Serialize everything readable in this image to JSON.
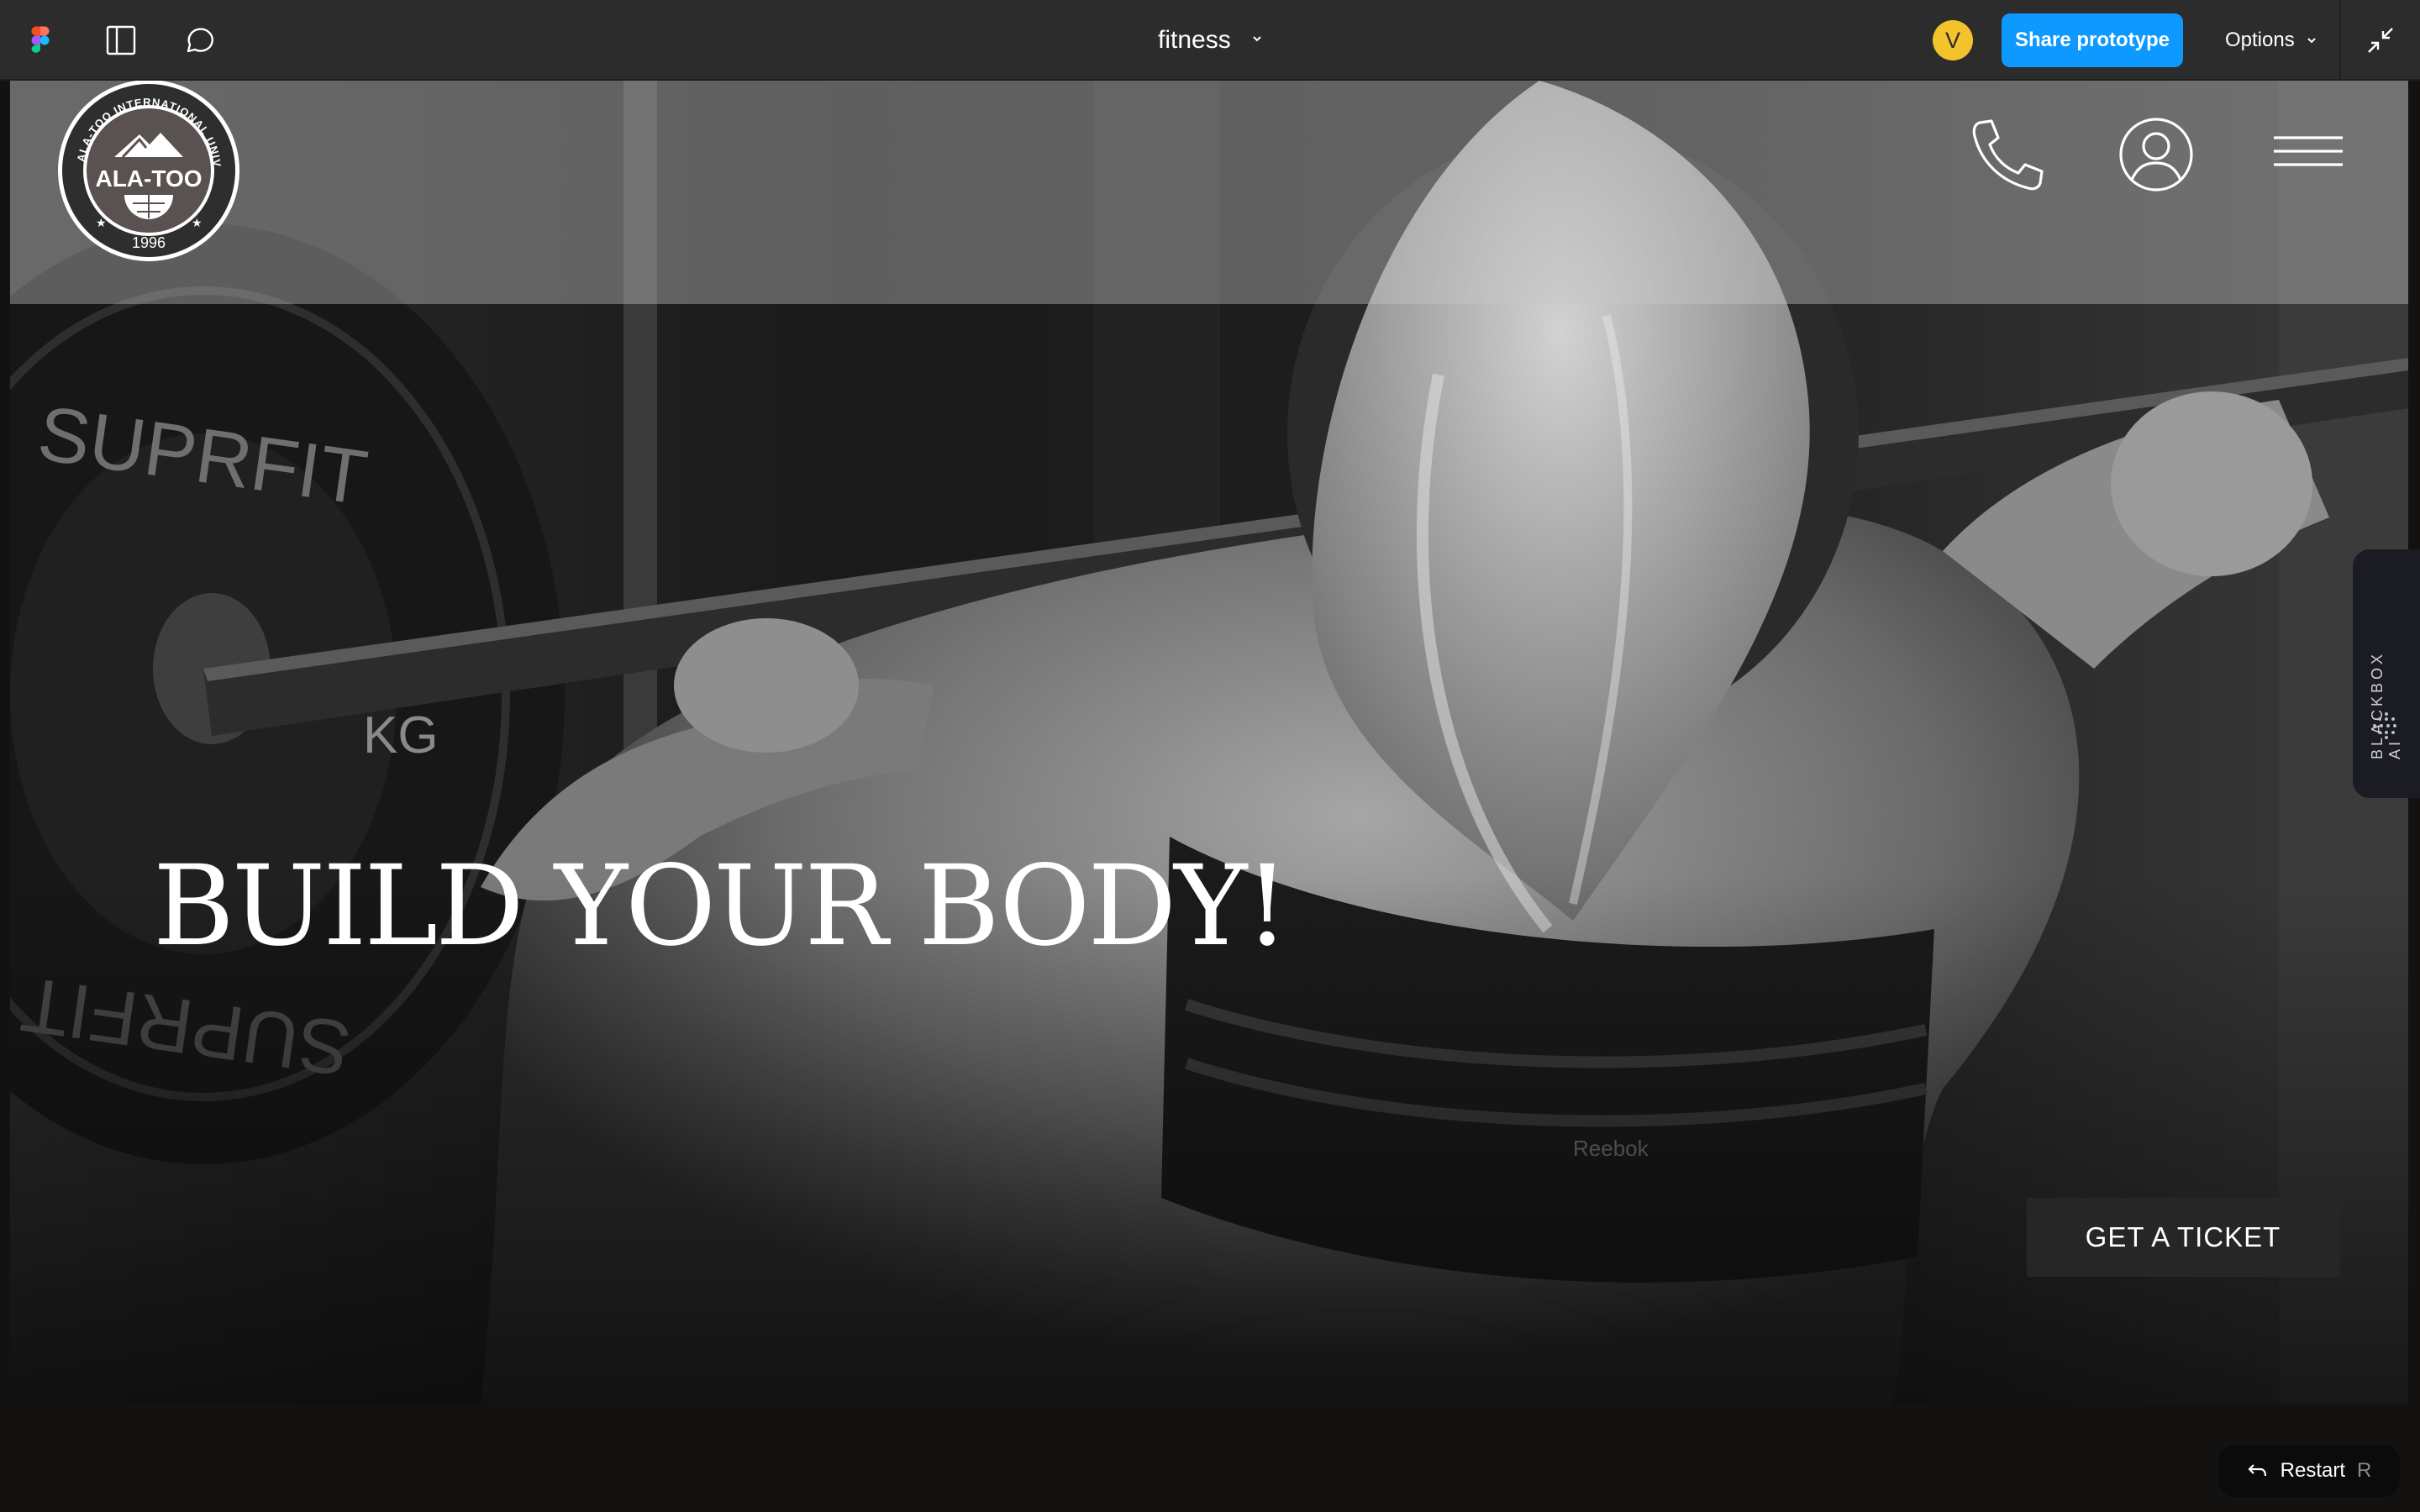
{
  "toolbar": {
    "file_name": "fitness",
    "avatar_initial": "V",
    "share_label": "Share prototype",
    "options_label": "Options",
    "accent_color": "#0d99ff",
    "avatar_color": "#f3c32b"
  },
  "site": {
    "logo": {
      "name": "ALA-TOO",
      "ring_text": "ALA-TOO INTERNATIONAL UNIVERSITY",
      "year": "1996"
    },
    "hero_title": "BUILD YOUR BODY!",
    "cta_label": "GET A TICKET",
    "bg_photo_text": {
      "plate_brand": "SUPRFIT",
      "plate_unit": "KG",
      "bra_brand": "Reebok"
    }
  },
  "plugin": {
    "label": "BLACKBOX AI"
  },
  "restart": {
    "label": "Restart",
    "shortcut": "R"
  },
  "icons": [
    "figma-logo",
    "panel-icon",
    "comment-icon",
    "chevron-down-icon",
    "collapse-icon",
    "phone-icon",
    "user-icon",
    "menu-icon",
    "back-arrow-icon"
  ]
}
